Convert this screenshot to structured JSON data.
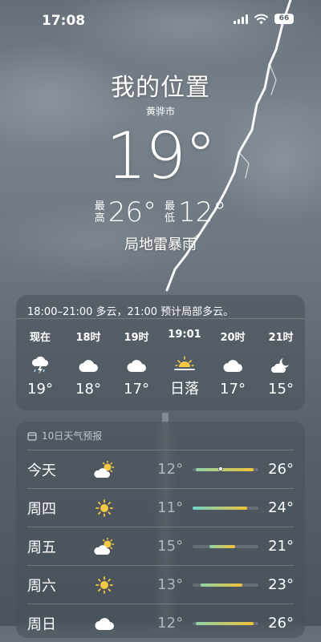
{
  "status": {
    "time": "17:08",
    "battery": "66"
  },
  "location": {
    "name": "我的位置",
    "sub": "黄骅市"
  },
  "current": {
    "temp": "19°",
    "high_label_1": "最",
    "high_label_2": "高",
    "high": "26°",
    "low_label_1": "最",
    "low_label_2": "低",
    "low": "12°",
    "condition": "局地雷暴雨"
  },
  "hourly": {
    "summary": "18:00–21:00 多云，21:00 预计局部多云。",
    "items": [
      {
        "time": "现在",
        "icon": "thunderstorm-icon",
        "value": "19°"
      },
      {
        "time": "18时",
        "icon": "cloud-icon",
        "value": "18°"
      },
      {
        "time": "19时",
        "icon": "cloud-icon",
        "value": "17°"
      },
      {
        "time": "19:01",
        "icon": "sunset-icon",
        "value": "日落"
      },
      {
        "time": "20时",
        "icon": "cloud-icon",
        "value": "17°"
      },
      {
        "time": "21时",
        "icon": "partly-cloudy-night-icon",
        "value": "15°"
      }
    ]
  },
  "forecast": {
    "title": "10日天气预报",
    "days": [
      {
        "day": "今天",
        "icon": "partly-sunny-icon",
        "low": "12°",
        "high": "26°",
        "range_start": 0.05,
        "range_end": 0.92,
        "current_pos": 0.42
      },
      {
        "day": "周四",
        "icon": "sun-icon",
        "low": "11°",
        "high": "24°",
        "range_start": 0.0,
        "range_end": 0.83
      },
      {
        "day": "周五",
        "icon": "partly-sunny-icon",
        "low": "15°",
        "high": "21°",
        "range_start": 0.25,
        "range_end": 0.65
      },
      {
        "day": "周六",
        "icon": "sun-icon",
        "low": "13°",
        "high": "23°",
        "range_start": 0.12,
        "range_end": 0.76
      },
      {
        "day": "周日",
        "icon": "cloud-icon",
        "low": "12°",
        "high": "26°",
        "range_start": 0.05,
        "range_end": 0.92
      }
    ]
  },
  "colors": {
    "range_cool": "#8fd3a8",
    "range_warm": "#f0c23a",
    "range_teal": "#6fd0c6"
  }
}
